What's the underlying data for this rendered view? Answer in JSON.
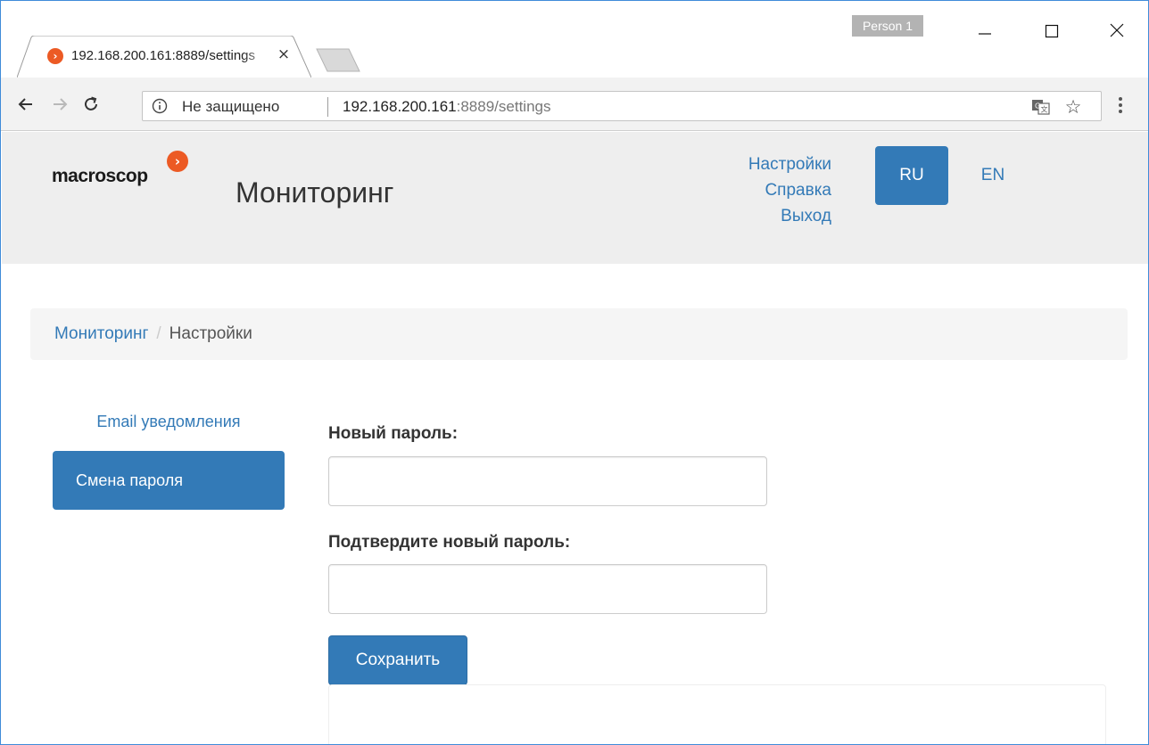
{
  "browser": {
    "tab_title": "192.168.200.161:8889/settings",
    "tab_close": "×",
    "profile": "Person 1",
    "security_label": "Не защищено",
    "url_host": "192.168.200.161",
    "url_rest": ":8889/settings",
    "star": "☆"
  },
  "header": {
    "logo_text": "macroscop",
    "logo_badge": "›",
    "title": "Мониторинг",
    "links": {
      "settings": "Настройки",
      "help": "Справка",
      "logout": "Выход"
    },
    "lang_ru": "RU",
    "lang_en": "EN"
  },
  "breadcrumb": {
    "home": "Мониторинг",
    "separator": "/",
    "current": "Настройки"
  },
  "sidebar": {
    "items": [
      {
        "label": "Email уведомления",
        "active": false
      },
      {
        "label": "Смена пароля",
        "active": true
      }
    ]
  },
  "form": {
    "new_password_label": "Новый пароль:",
    "new_password_value": "",
    "confirm_password_label": "Подтвердите новый пароль:",
    "confirm_password_value": "",
    "save_label": "Сохранить"
  },
  "colors": {
    "primary": "#337ab7",
    "brand_orange": "#ec5a24",
    "header_bg": "#eeeeee"
  }
}
